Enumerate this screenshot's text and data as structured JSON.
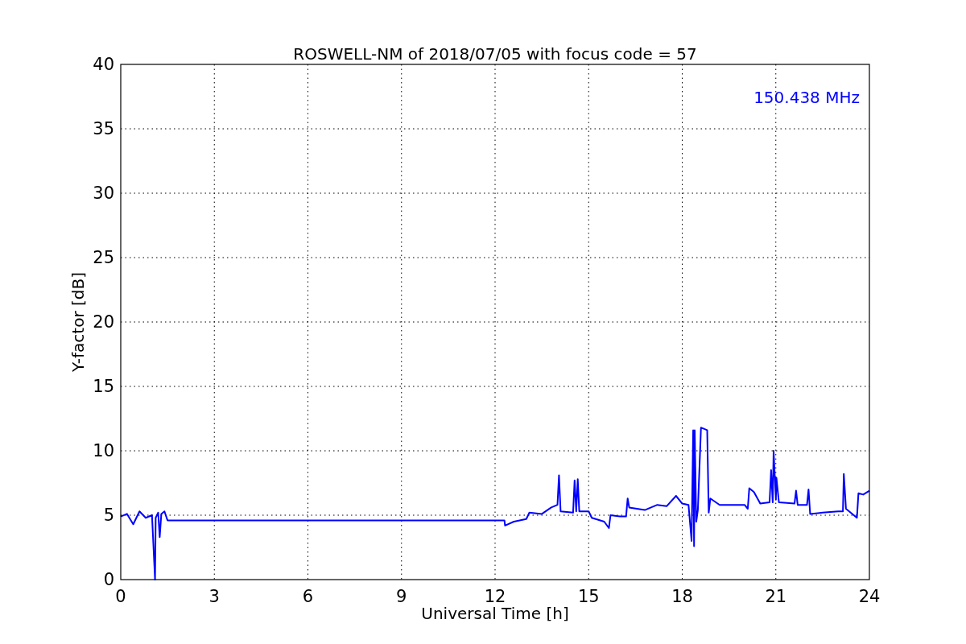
{
  "figure": {
    "chart_data": {
      "type": "line",
      "title": "ROSWELL-NM of 2018/07/05 with focus code = 57",
      "xlabel": "Universal Time [h]",
      "ylabel": "Y-factor [dB]",
      "x": [
        0,
        0.2,
        0.4,
        0.6,
        0.8,
        1.0,
        1.1,
        1.12,
        1.2,
        1.25,
        1.3,
        1.4,
        1.5,
        12.3,
        12.32,
        12.6,
        13.0,
        13.1,
        13.5,
        13.8,
        14.0,
        14.05,
        14.1,
        14.5,
        14.55,
        14.6,
        14.65,
        14.7,
        15.0,
        15.1,
        15.5,
        15.65,
        15.7,
        16.0,
        16.2,
        16.25,
        16.3,
        16.8,
        17.2,
        17.5,
        17.8,
        18.0,
        18.2,
        18.3,
        18.35,
        18.38,
        18.4,
        18.45,
        18.5,
        18.6,
        18.8,
        18.85,
        18.9,
        19.2,
        20.0,
        20.1,
        20.15,
        20.3,
        20.5,
        20.8,
        20.85,
        20.9,
        20.93,
        21.0,
        21.02,
        21.1,
        21.6,
        21.65,
        21.7,
        22.0,
        22.05,
        22.1,
        22.5,
        23.0,
        23.15,
        23.18,
        23.25,
        23.5,
        23.6,
        23.65,
        23.8,
        24.0
      ],
      "series": [
        {
          "name": "150.438 MHz",
          "color": "#0000ff",
          "values": [
            4.9,
            5.1,
            4.3,
            5.3,
            4.8,
            5.0,
            0,
            4.8,
            5.2,
            3.3,
            5.1,
            5.3,
            4.6,
            4.6,
            4.2,
            4.5,
            4.7,
            5.2,
            5.1,
            5.6,
            5.8,
            8.1,
            5.3,
            5.2,
            7.7,
            5.3,
            7.8,
            5.3,
            5.3,
            4.8,
            4.5,
            4.0,
            5.0,
            4.9,
            4.9,
            6.3,
            5.6,
            5.4,
            5.8,
            5.7,
            6.5,
            5.9,
            5.8,
            3.0,
            11.6,
            2.6,
            11.6,
            4.5,
            5.4,
            11.8,
            11.6,
            5.2,
            6.3,
            5.8,
            5.8,
            5.5,
            7.1,
            6.8,
            5.9,
            6.0,
            8.5,
            6.0,
            10.0,
            6.2,
            7.9,
            6.0,
            5.9,
            6.9,
            5.8,
            5.8,
            7.0,
            5.1,
            5.2,
            5.3,
            5.3,
            8.2,
            5.5,
            5.0,
            4.8,
            6.7,
            6.6,
            6.9
          ]
        }
      ],
      "xlim": [
        0,
        24
      ],
      "ylim": [
        0,
        40
      ],
      "xticks": [
        0,
        3,
        6,
        9,
        12,
        15,
        18,
        21,
        24
      ],
      "yticks": [
        0,
        5,
        10,
        15,
        20,
        25,
        30,
        35,
        40
      ],
      "grid": true
    }
  }
}
